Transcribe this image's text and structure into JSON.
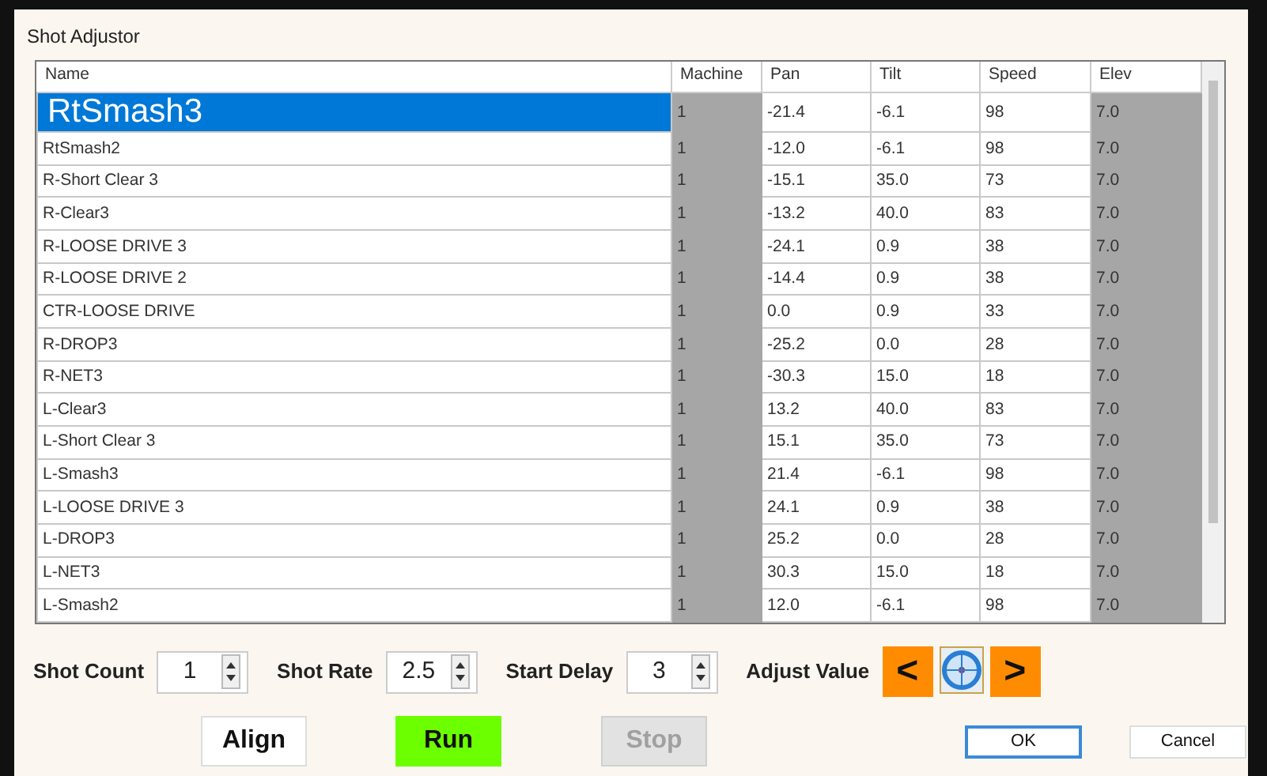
{
  "window": {
    "title": "Shot Adjustor"
  },
  "table": {
    "columns": [
      {
        "label": "Name",
        "readonly": false
      },
      {
        "label": "Machine",
        "readonly": true
      },
      {
        "label": "Pan",
        "readonly": false
      },
      {
        "label": "Tilt",
        "readonly": false
      },
      {
        "label": "Speed",
        "readonly": false
      },
      {
        "label": "Elev",
        "readonly": true
      }
    ],
    "rows": [
      {
        "cells": [
          "RtSmash3",
          "1",
          "-21.4",
          "-6.1",
          "98",
          "7.0"
        ],
        "selected": true
      },
      {
        "cells": [
          "RtSmash2",
          "1",
          "-12.0",
          "-6.1",
          "98",
          "7.0"
        ],
        "selected": false
      },
      {
        "cells": [
          "R-Short Clear 3",
          "1",
          "-15.1",
          "35.0",
          "73",
          "7.0"
        ],
        "selected": false
      },
      {
        "cells": [
          "R-Clear3",
          "1",
          "-13.2",
          "40.0",
          "83",
          "7.0"
        ],
        "selected": false
      },
      {
        "cells": [
          "R-LOOSE DRIVE 3",
          "1",
          "-24.1",
          "0.9",
          "38",
          "7.0"
        ],
        "selected": false
      },
      {
        "cells": [
          "R-LOOSE DRIVE 2",
          "1",
          "-14.4",
          "0.9",
          "38",
          "7.0"
        ],
        "selected": false
      },
      {
        "cells": [
          "CTR-LOOSE DRIVE",
          "1",
          "0.0",
          "0.9",
          "33",
          "7.0"
        ],
        "selected": false
      },
      {
        "cells": [
          "R-DROP3",
          "1",
          "-25.2",
          "0.0",
          "28",
          "7.0"
        ],
        "selected": false
      },
      {
        "cells": [
          "R-NET3",
          "1",
          "-30.3",
          "15.0",
          "18",
          "7.0"
        ],
        "selected": false
      },
      {
        "cells": [
          "L-Clear3",
          "1",
          "13.2",
          "40.0",
          "83",
          "7.0"
        ],
        "selected": false
      },
      {
        "cells": [
          "L-Short Clear 3",
          "1",
          "15.1",
          "35.0",
          "73",
          "7.0"
        ],
        "selected": false
      },
      {
        "cells": [
          "L-Smash3",
          "1",
          "21.4",
          "-6.1",
          "98",
          "7.0"
        ],
        "selected": false
      },
      {
        "cells": [
          "L-LOOSE DRIVE 3",
          "1",
          "24.1",
          "0.9",
          "38",
          "7.0"
        ],
        "selected": false
      },
      {
        "cells": [
          "L-DROP3",
          "1",
          "25.2",
          "0.0",
          "28",
          "7.0"
        ],
        "selected": false
      },
      {
        "cells": [
          "L-NET3",
          "1",
          "30.3",
          "15.0",
          "18",
          "7.0"
        ],
        "selected": false
      },
      {
        "cells": [
          "L-Smash2",
          "1",
          "12.0",
          "-6.1",
          "98",
          "7.0"
        ],
        "selected": false
      }
    ]
  },
  "settings": [
    {
      "label": "Shot Count",
      "value": "1"
    },
    {
      "label": "Shot Rate",
      "value": "2.5"
    },
    {
      "label": "Start Delay",
      "value": "3"
    }
  ],
  "adjust": {
    "label": "Adjust Value",
    "left": "<",
    "right": ">"
  },
  "buttons": [
    {
      "label": "Align",
      "kind": "plain",
      "disabled": false
    },
    {
      "label": "Run",
      "kind": "go",
      "disabled": false
    },
    {
      "label": "Stop",
      "kind": "plain",
      "disabled": true
    },
    {
      "label": "OK",
      "kind": "default",
      "disabled": false
    },
    {
      "label": "Cancel",
      "kind": "plain",
      "disabled": false
    }
  ]
}
